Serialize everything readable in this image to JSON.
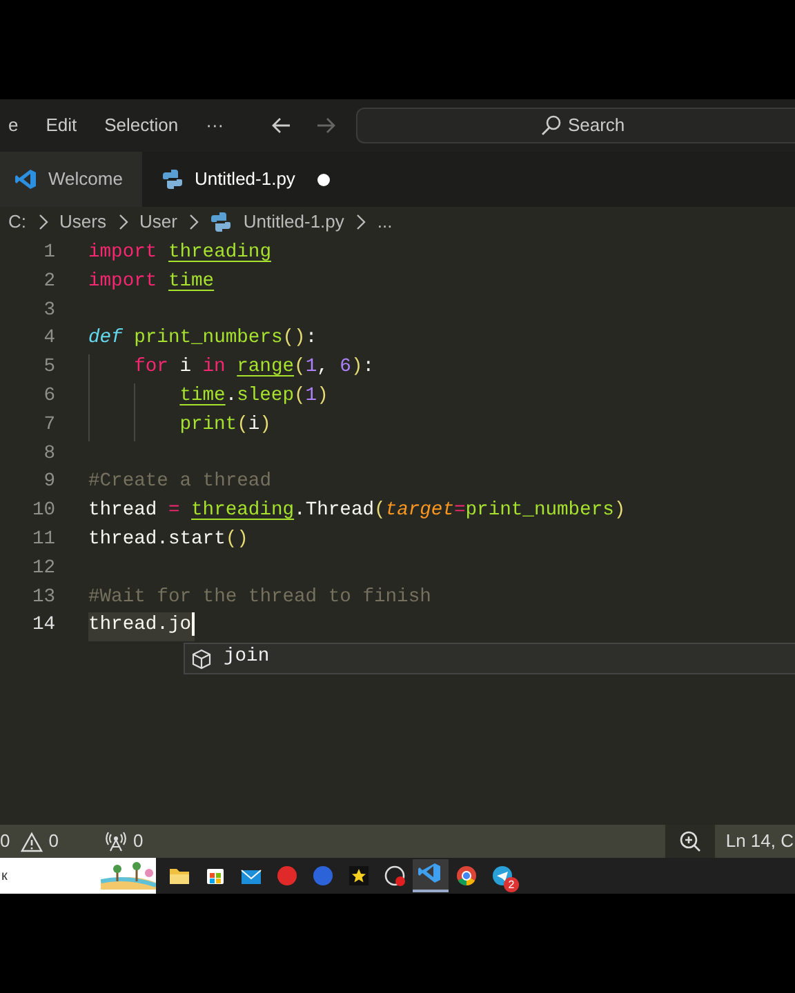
{
  "menu": [
    {
      "label": "e"
    },
    {
      "label": "Edit"
    },
    {
      "label": "Selection"
    },
    {
      "label": "···"
    }
  ],
  "nav": {
    "back_enabled": true,
    "forward_enabled": false
  },
  "search": {
    "placeholder": "Search"
  },
  "tabs": [
    {
      "label": "Welcome",
      "kind": "welcome",
      "selected": false,
      "dirty": false
    },
    {
      "label": "Untitled-1.py",
      "kind": "python",
      "selected": true,
      "dirty": true
    }
  ],
  "breadcrumb": [
    {
      "label": "C:",
      "kind": "folder"
    },
    {
      "label": "Users",
      "kind": "folder"
    },
    {
      "label": "User",
      "kind": "folder"
    },
    {
      "label": "Untitled-1.py",
      "kind": "python"
    },
    {
      "label": "...",
      "kind": "symbol"
    }
  ],
  "code": [
    {
      "number": "1",
      "current": false,
      "tokens": [
        {
          "kind": "kw",
          "text": "import "
        },
        {
          "kind": "mod",
          "text": "threading"
        }
      ]
    },
    {
      "number": "2",
      "current": false,
      "tokens": [
        {
          "kind": "kw",
          "text": "import "
        },
        {
          "kind": "mod",
          "text": "time"
        }
      ]
    },
    {
      "number": "3",
      "current": false
    },
    {
      "number": "4",
      "current": false,
      "tokens": [
        {
          "kind": "def",
          "text": "def"
        },
        {
          "kind": "fn",
          "text": " print_numbers"
        },
        {
          "kind": "paren",
          "text": "()"
        },
        {
          "kind": "plain",
          "text": ":"
        }
      ],
      "children": [
        {
          "number": "5",
          "current": false,
          "tokens": [
            {
              "kind": "kw",
              "text": "for"
            },
            {
              "kind": "plain",
              "text": " i "
            },
            {
              "kind": "kw",
              "text": "in "
            },
            {
              "kind": "mod",
              "text": "range"
            },
            {
              "kind": "paren",
              "text": "("
            },
            {
              "kind": "num",
              "text": "1"
            },
            {
              "kind": "plain",
              "text": ", "
            },
            {
              "kind": "num",
              "text": "6"
            },
            {
              "kind": "paren",
              "text": ")"
            },
            {
              "kind": "plain",
              "text": ":"
            }
          ],
          "children": [
            {
              "number": "6",
              "current": false,
              "tokens": [
                {
                  "kind": "mod",
                  "text": "time"
                },
                {
                  "kind": "plain",
                  "text": "."
                },
                {
                  "kind": "fn",
                  "text": "sleep"
                },
                {
                  "kind": "paren",
                  "text": "("
                },
                {
                  "kind": "num",
                  "text": "1"
                },
                {
                  "kind": "paren",
                  "text": ")"
                }
              ]
            },
            {
              "number": "7",
              "current": false,
              "tokens": [
                {
                  "kind": "fn",
                  "text": "print"
                },
                {
                  "kind": "paren",
                  "text": "("
                },
                {
                  "kind": "plain",
                  "text": "i"
                },
                {
                  "kind": "paren",
                  "text": ")"
                }
              ]
            }
          ]
        }
      ]
    },
    {
      "number": "8",
      "current": false
    },
    {
      "number": "9",
      "current": false,
      "tokens": [
        {
          "kind": "comment",
          "text": "#Create a thread"
        }
      ]
    },
    {
      "number": "10",
      "current": false,
      "tokens": [
        {
          "kind": "plain",
          "text": "thread "
        },
        {
          "kind": "op",
          "text": "= "
        },
        {
          "kind": "mod",
          "text": "threading"
        },
        {
          "kind": "plain",
          "text": ".Thread"
        },
        {
          "kind": "paren",
          "text": "("
        },
        {
          "kind": "param",
          "text": "target"
        },
        {
          "kind": "op",
          "text": "="
        },
        {
          "kind": "fn",
          "text": "print_numbers"
        },
        {
          "kind": "paren",
          "text": ")"
        }
      ]
    },
    {
      "number": "11",
      "current": false,
      "tokens": [
        {
          "kind": "plain",
          "text": "thread.start"
        },
        {
          "kind": "paren",
          "text": "()"
        }
      ]
    },
    {
      "number": "12",
      "current": false
    },
    {
      "number": "13",
      "current": false,
      "tokens": [
        {
          "kind": "comment",
          "text": "#Wait for the thread to finish"
        }
      ]
    },
    {
      "number": "14",
      "current": true,
      "tokens": [
        {
          "kind": "plain",
          "text": "thread.jo"
        }
      ]
    }
  ],
  "suggestions": [
    {
      "label": "join",
      "selected": true
    }
  ],
  "status_bar": {
    "errors": "0",
    "warnings": "0",
    "ports": "0",
    "position": "Ln 14, C"
  },
  "taskbar": {
    "search_text": "к",
    "apps": [
      {
        "kind": "folder",
        "active": false
      },
      {
        "kind": "store",
        "active": false
      },
      {
        "kind": "mail",
        "active": false
      },
      {
        "kind": "red-circle",
        "active": false
      },
      {
        "kind": "blue-circle",
        "active": false
      },
      {
        "kind": "star",
        "active": false
      },
      {
        "kind": "record",
        "active": false
      },
      {
        "kind": "vscode",
        "active": true
      },
      {
        "kind": "chrome",
        "active": false
      },
      {
        "kind": "telegram",
        "active": false,
        "badge": "2"
      }
    ]
  }
}
